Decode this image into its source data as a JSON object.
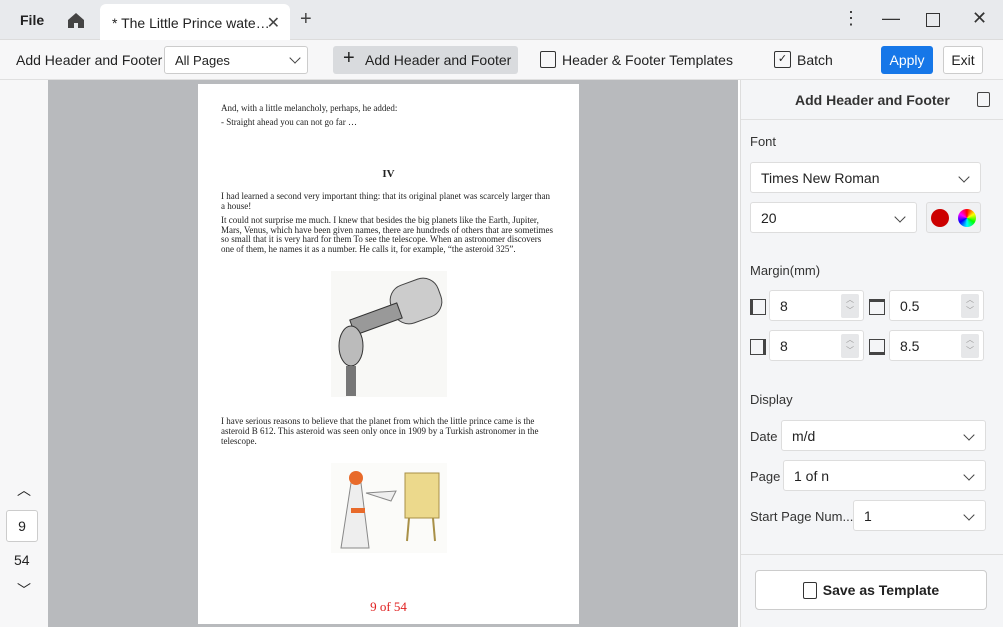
{
  "titlebar": {
    "file": "File",
    "tab_title": "* The Little Prince wate…"
  },
  "toolbar": {
    "label": "Add Header and Footer",
    "pages": "All Pages",
    "add": "Add Header and Footer",
    "templates": "Header & Footer Templates",
    "batch": "Batch",
    "apply": "Apply",
    "exit": "Exit"
  },
  "nav": {
    "current_page": "9",
    "total_pages": "54"
  },
  "document": {
    "p1": "And, with a little melancholy, perhaps, he added:",
    "p2": "- Straight ahead you can not go far …",
    "chapter": "IV",
    "p3": "I had learned a second very important thing: that its original planet was scarcely larger than a house!",
    "p4": "It could not surprise me much. I knew that besides the big planets like the Earth, Jupiter, Mars, Venus, which have been given names, there are hundreds of others that are sometimes so small that it is very hard for them To see the telescope. When an astronomer discovers one of them, he names it as a number. He calls it, for example, “the asteroid 325”.",
    "p5": "I have serious reasons to believe that the planet from which the little prince came is the asteroid B 612. This asteroid was seen only once in 1909 by a Turkish astronomer in the telescope.",
    "footer": "9 of 54"
  },
  "panel": {
    "title": "Add Header and Footer",
    "font_label": "Font",
    "font": "Times New Roman",
    "size": "20",
    "color": "#cc0000",
    "margin_label": "Margin(mm)",
    "left": "8",
    "top": "0.5",
    "right": "8",
    "bottom": "8.5",
    "display_label": "Display",
    "date_label": "Date",
    "date": "m/d",
    "page_label": "Page",
    "page": "1 of n",
    "start_label": "Start Page Num...",
    "start": "1",
    "save": "Save as Template"
  }
}
